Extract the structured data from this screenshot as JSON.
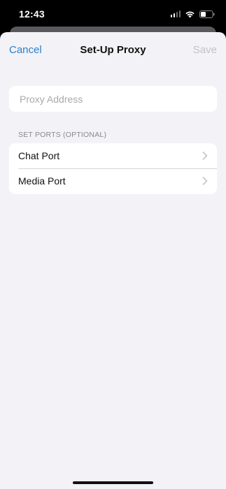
{
  "status_bar": {
    "time": "12:43"
  },
  "nav": {
    "cancel_label": "Cancel",
    "title": "Set-Up Proxy",
    "save_label": "Save"
  },
  "proxy": {
    "address_value": "",
    "address_placeholder": "Proxy Address"
  },
  "ports": {
    "section_header": "SET PORTS (OPTIONAL)",
    "items": [
      {
        "label": "Chat Port",
        "icon": "chevron-right-icon"
      },
      {
        "label": "Media Port",
        "icon": "chevron-right-icon"
      }
    ]
  },
  "colors": {
    "accent": "#2f7fc5",
    "disabled": "#c2c2c6",
    "background": "#f2f2f7"
  }
}
